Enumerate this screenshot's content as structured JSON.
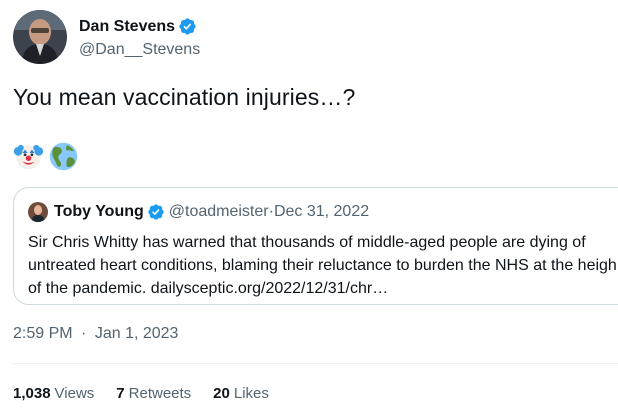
{
  "author": {
    "display_name": "Dan Stevens",
    "handle": "@Dan__Stevens",
    "verified": true
  },
  "tweet": {
    "text": "You mean vaccination injuries…?",
    "emojis": [
      "clown-face",
      "globe-americas"
    ]
  },
  "quote": {
    "display_name": "Toby Young",
    "handle": "@toadmeister",
    "separator": "·",
    "date": "Dec 31, 2022",
    "text": "Sir Chris Whitty has warned that thousands of middle-aged people are dying of untreated heart conditions, blaming their reluctance to burden the NHS at the heigh of the pandemic. dailysceptic.org/2022/12/31/chr…"
  },
  "timestamp": {
    "time": "2:59 PM",
    "separator": "·",
    "date": "Jan 1, 2023"
  },
  "stats": [
    {
      "count": "1,038",
      "label": "Views"
    },
    {
      "count": "7",
      "label": "Retweets"
    },
    {
      "count": "20",
      "label": "Likes"
    }
  ],
  "colors": {
    "verified": "#1d9bf0",
    "secondary_text": "#536471",
    "primary_text": "#0f1419",
    "border": "#cfd9de"
  }
}
